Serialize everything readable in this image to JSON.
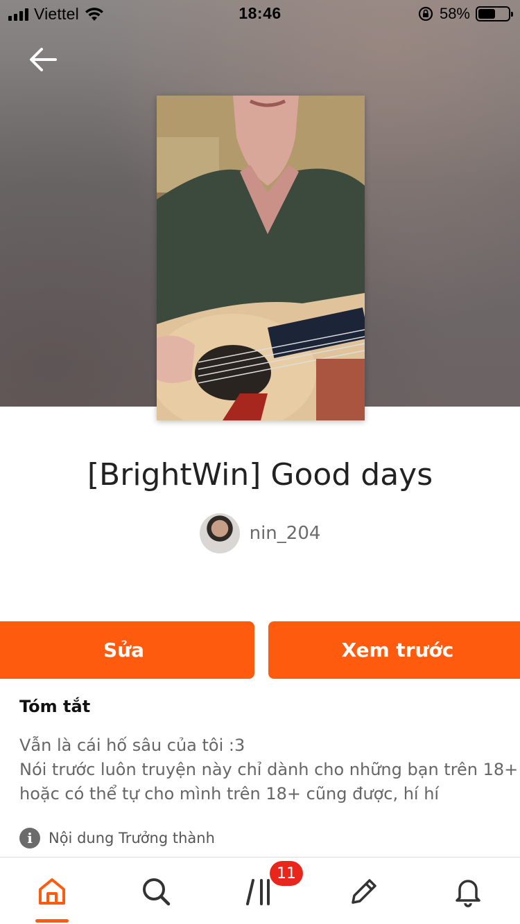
{
  "status_bar": {
    "carrier": "Viettel",
    "time": "18:46",
    "battery_percent": "58%",
    "battery_level": 0.58
  },
  "nav": {
    "back_icon": "arrow-left-icon"
  },
  "story": {
    "title": "[BrightWin] Good days",
    "author": "nin_204"
  },
  "actions": {
    "edit_label": "Sửa",
    "preview_label": "Xem trước",
    "accent_color": "#ff5b0f"
  },
  "summary": {
    "heading": "Tóm tắt",
    "lines": [
      "Vẫn là cái hố sâu của tôi :3",
      "Nói trước luôn truyện này chỉ dành cho những bạn trên 18+",
      "hoặc có thể tự cho mình trên 18+ cũng được, hí hí"
    ]
  },
  "content_rating": {
    "icon": "info-icon",
    "label": "Nội dung Trưởng thành"
  },
  "tab_bar": {
    "active": "home",
    "items": [
      {
        "id": "home",
        "icon": "home-icon"
      },
      {
        "id": "search",
        "icon": "search-icon"
      },
      {
        "id": "library",
        "icon": "library-icon"
      },
      {
        "id": "write",
        "icon": "pencil-icon"
      },
      {
        "id": "notifications",
        "icon": "bell-icon"
      }
    ],
    "library_badge": "11"
  }
}
